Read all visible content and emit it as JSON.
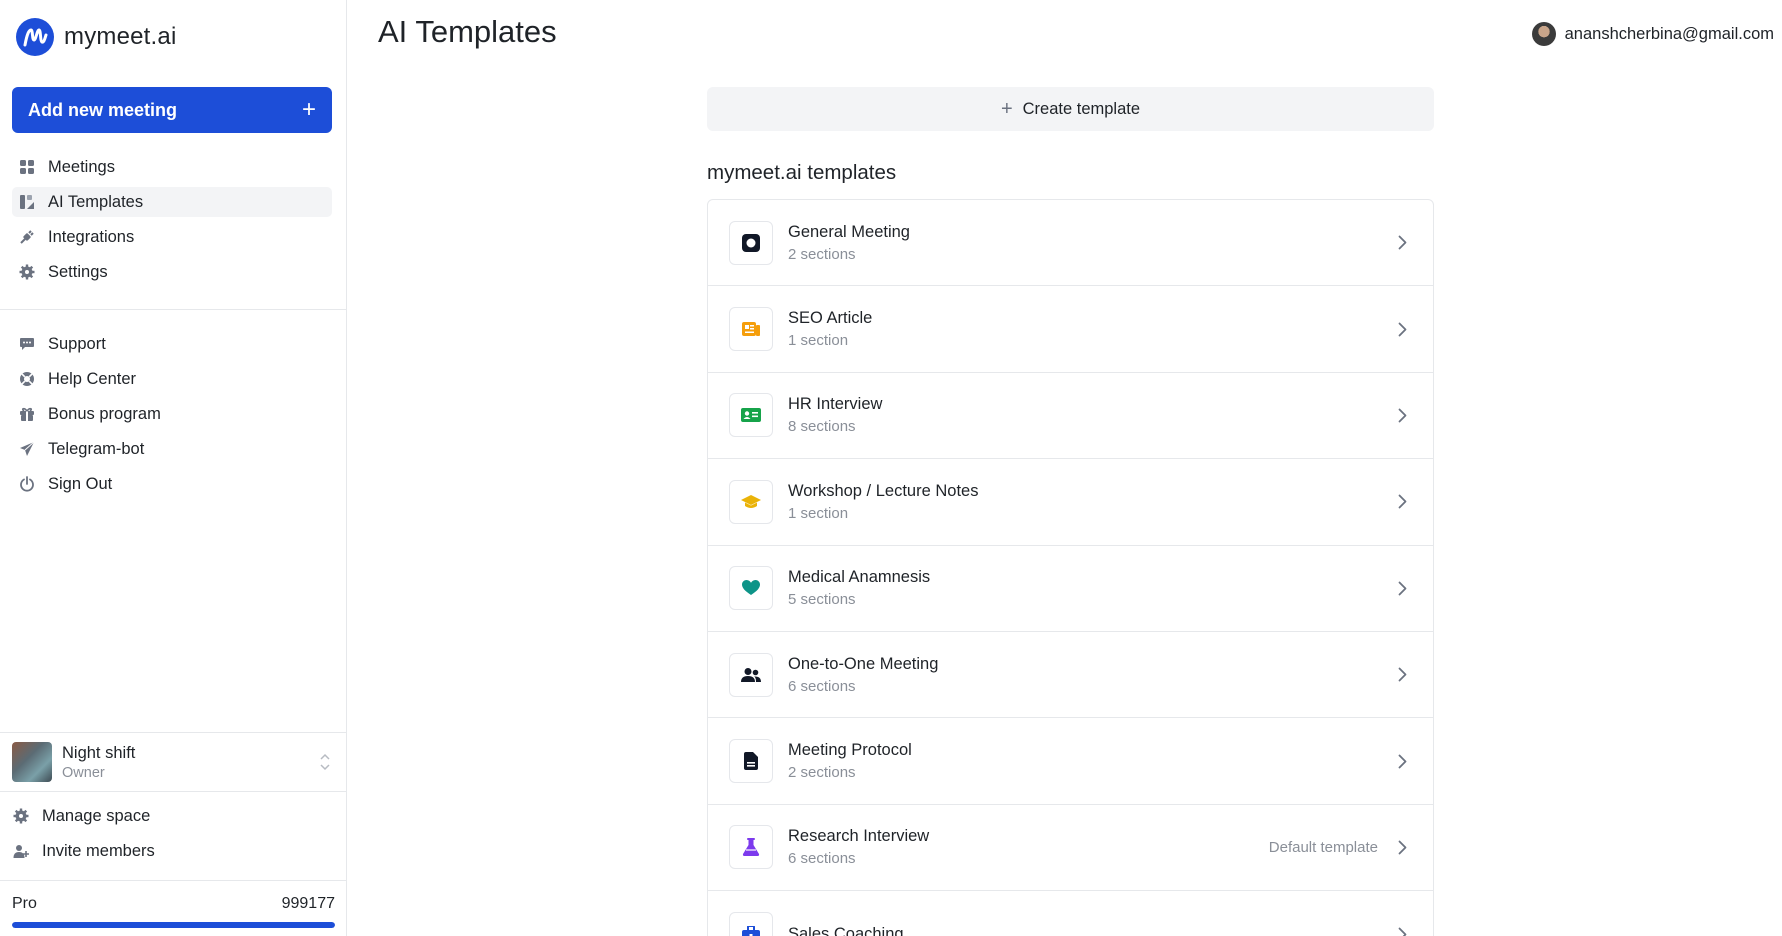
{
  "app": {
    "brand_name": "mymeet.ai",
    "page_title": "AI Templates",
    "user_email": "ananshcherbina@gmail.com"
  },
  "sidebar": {
    "add_button_label": "Add new meeting",
    "main_items": [
      {
        "label": "Meetings",
        "icon": "grid-icon",
        "active": false
      },
      {
        "label": "AI Templates",
        "icon": "templates-icon",
        "active": true
      },
      {
        "label": "Integrations",
        "icon": "plug-icon",
        "active": false
      },
      {
        "label": "Settings",
        "icon": "gear-icon",
        "active": false
      }
    ],
    "secondary_items": [
      {
        "label": "Support",
        "icon": "chat-icon"
      },
      {
        "label": "Help Center",
        "icon": "lifebuoy-icon"
      },
      {
        "label": "Bonus program",
        "icon": "gift-icon"
      },
      {
        "label": "Telegram-bot",
        "icon": "paper-plane-icon"
      },
      {
        "label": "Sign Out",
        "icon": "power-icon"
      }
    ],
    "workspace": {
      "name": "Night shift",
      "role": "Owner"
    },
    "space_items": [
      {
        "label": "Manage space",
        "icon": "gear-icon"
      },
      {
        "label": "Invite members",
        "icon": "user-plus-icon"
      }
    ],
    "plan": {
      "name": "Pro",
      "value": "999177",
      "progress": 1.0
    }
  },
  "main": {
    "create_label": "Create template",
    "section_title": "mymeet.ai templates",
    "templates": [
      {
        "name": "General Meeting",
        "sub": "2 sections",
        "icon": "circle-square-icon",
        "color": "#111827",
        "badge": ""
      },
      {
        "name": "SEO Article",
        "sub": "1 section",
        "icon": "newspaper-icon",
        "color": "#f59e0b",
        "badge": ""
      },
      {
        "name": "HR Interview",
        "sub": "8 sections",
        "icon": "id-card-icon",
        "color": "#16a34a",
        "badge": ""
      },
      {
        "name": "Workshop / Lecture Notes",
        "sub": "1 section",
        "icon": "graduation-cap-icon",
        "color": "#eab308",
        "badge": ""
      },
      {
        "name": "Medical Anamnesis",
        "sub": "5 sections",
        "icon": "heart-icon",
        "color": "#0d9488",
        "badge": ""
      },
      {
        "name": "One-to-One Meeting",
        "sub": "6 sections",
        "icon": "users-icon",
        "color": "#111827",
        "badge": ""
      },
      {
        "name": "Meeting Protocol",
        "sub": "2 sections",
        "icon": "document-icon",
        "color": "#111827",
        "badge": ""
      },
      {
        "name": "Research Interview",
        "sub": "6 sections",
        "icon": "flask-icon",
        "color": "#7c3aed",
        "badge": "Default template"
      },
      {
        "name": "Sales Coaching",
        "sub": "",
        "icon": "briefcase-icon",
        "color": "#1d4ed8",
        "badge": ""
      }
    ]
  }
}
